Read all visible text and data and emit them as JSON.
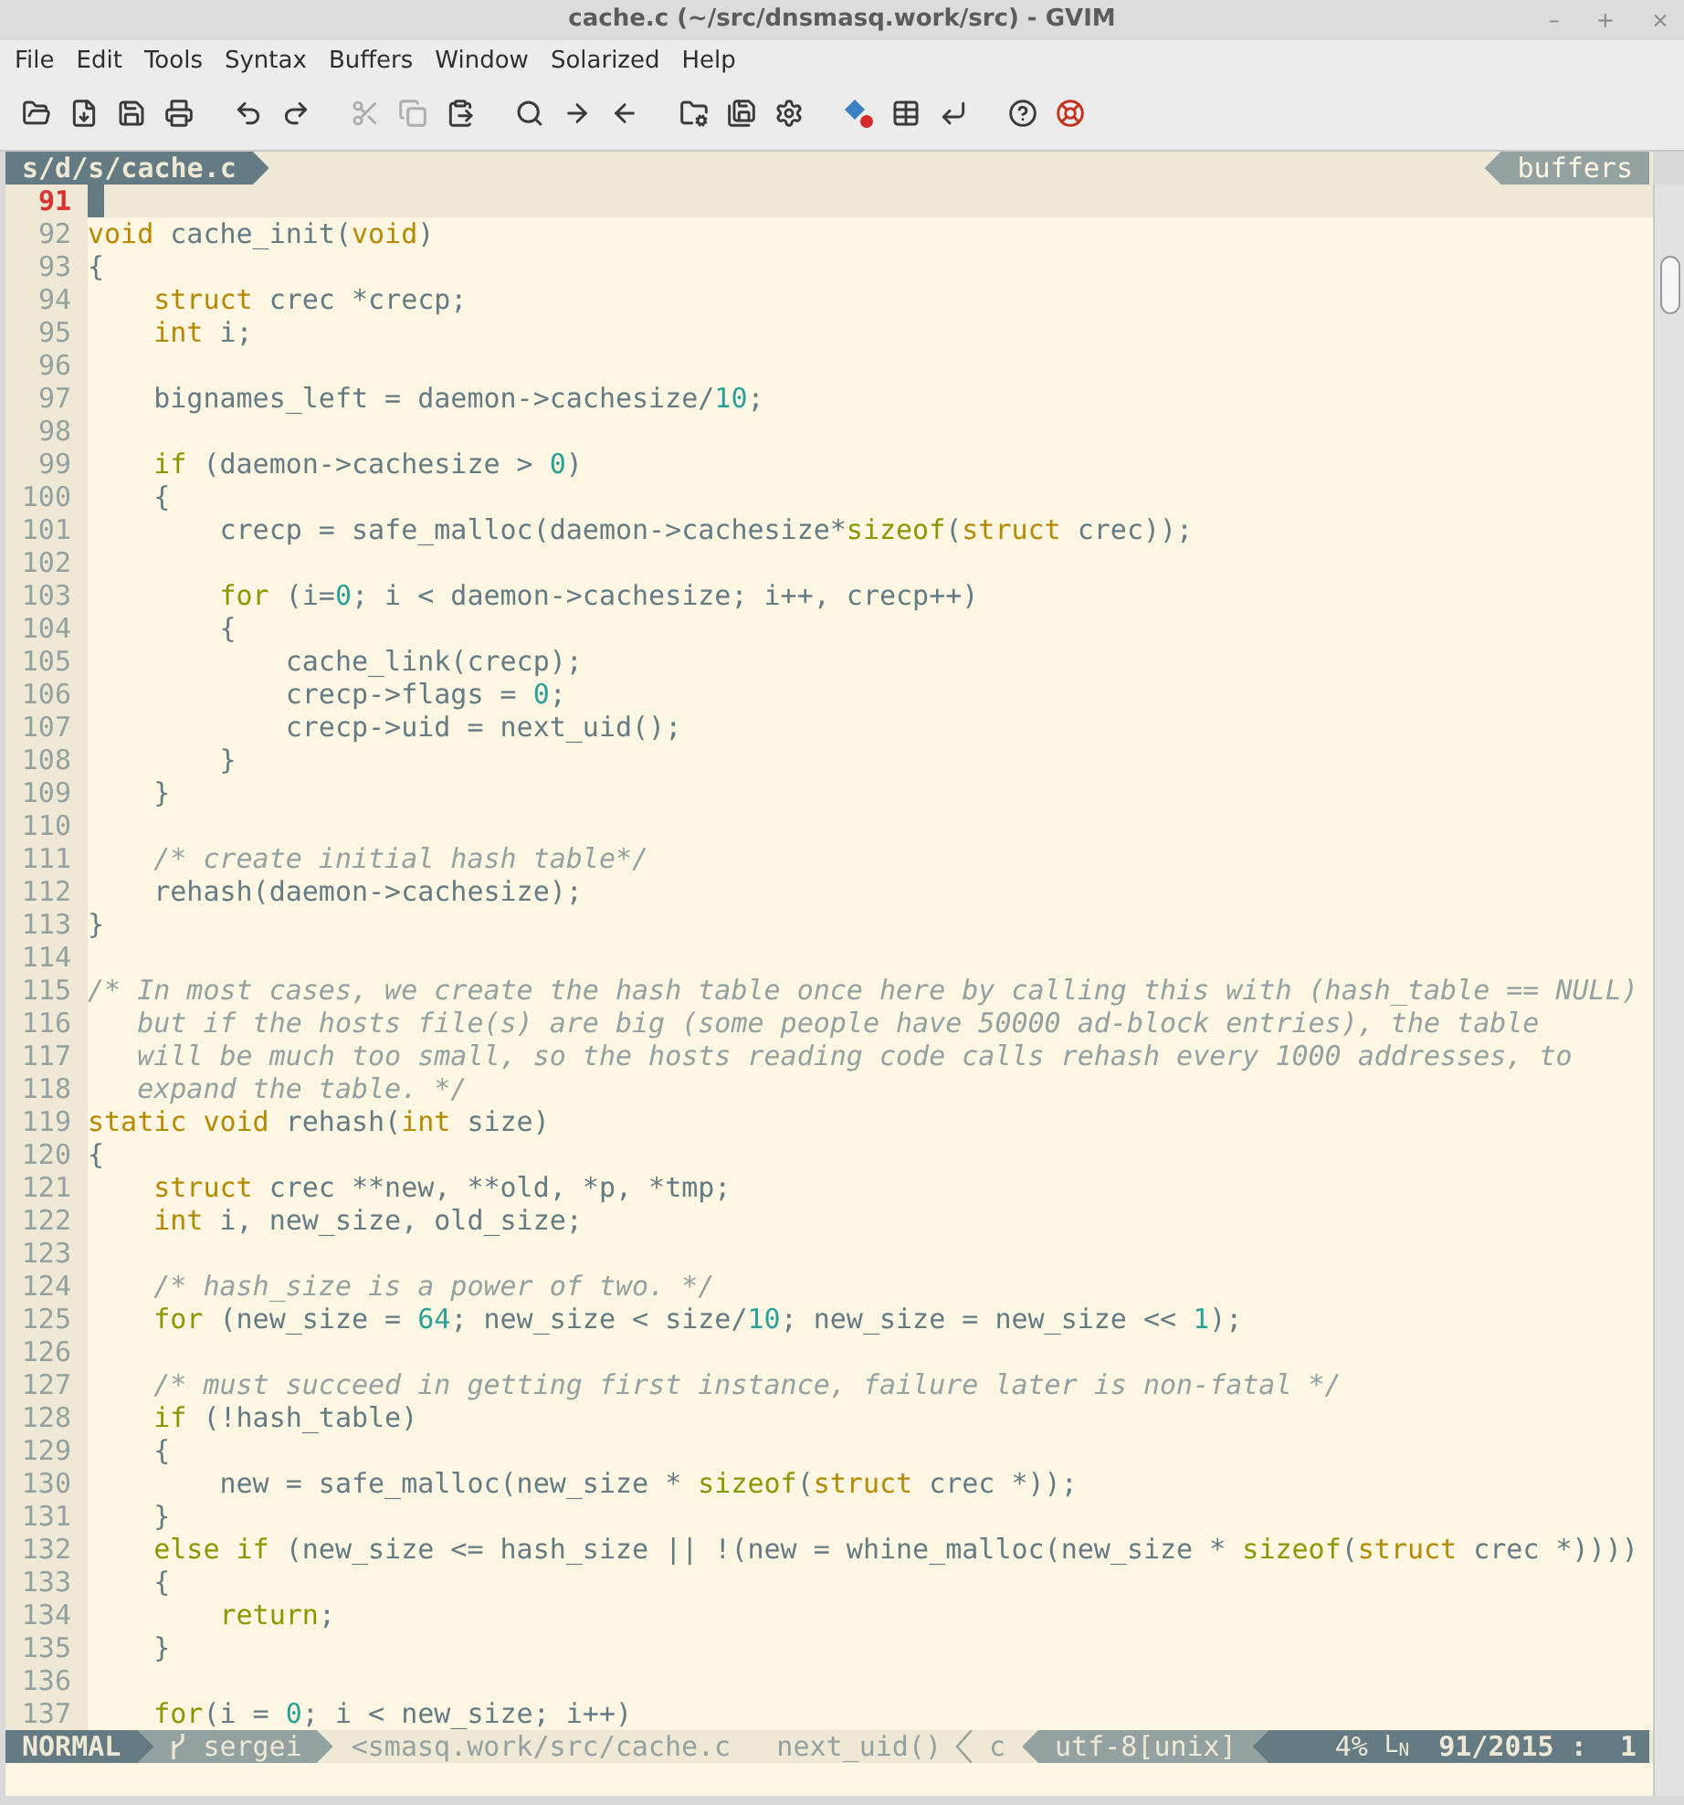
{
  "window": {
    "title": "cache.c (~/src/dnsmasq.work/src) - GVIM",
    "controls": [
      "–",
      "+",
      "×"
    ]
  },
  "menu": [
    "File",
    "Edit",
    "Tools",
    "Syntax",
    "Buffers",
    "Window",
    "Solarized",
    "Help"
  ],
  "toolbar": {
    "groups": [
      {
        "buttons": [
          {
            "disabled": false
          },
          {
            "disabled": false
          },
          {
            "disabled": false
          },
          {
            "disabled": false
          }
        ]
      },
      {
        "buttons": [
          {
            "disabled": false
          },
          {
            "disabled": false
          }
        ]
      },
      {
        "buttons": [
          {
            "disabled": true
          },
          {
            "disabled": true
          },
          {
            "disabled": false
          }
        ]
      },
      {
        "buttons": [
          {
            "disabled": false
          },
          {
            "disabled": false
          },
          {
            "disabled": false
          }
        ]
      },
      {
        "buttons": [
          {
            "disabled": false
          },
          {
            "disabled": false
          },
          {
            "disabled": false
          }
        ]
      },
      {
        "buttons": [
          {
            "disabled": false
          },
          {
            "disabled": false
          },
          {
            "disabled": false
          }
        ]
      },
      {
        "buttons": [
          {
            "disabled": false
          },
          {
            "disabled": false
          }
        ]
      }
    ]
  },
  "tabline": {
    "tab": "s/d/s/cache.c",
    "label": "buffers"
  },
  "editor": {
    "cursor_line": {
      "number": "91"
    },
    "lines": [
      {
        "number": "92",
        "segments": [
          {
            "kind": "type",
            "text": "void"
          },
          {
            "kind": "plain",
            "text": " cache_init("
          },
          {
            "kind": "type",
            "text": "void"
          },
          {
            "kind": "plain",
            "text": ")"
          }
        ]
      },
      {
        "number": "93",
        "segments": [
          {
            "kind": "plain",
            "text": "{"
          }
        ]
      },
      {
        "number": "94",
        "segments": [
          {
            "kind": "type",
            "text": "    struct"
          },
          {
            "kind": "plain",
            "text": " crec *crecp;"
          }
        ]
      },
      {
        "number": "95",
        "segments": [
          {
            "kind": "type",
            "text": "    int"
          },
          {
            "kind": "plain",
            "text": " i;"
          }
        ]
      },
      {
        "number": "96"
      },
      {
        "number": "97",
        "segments": [
          {
            "kind": "plain",
            "text": "    bignames_left = daemon->cachesize/"
          },
          {
            "kind": "number",
            "text": "10"
          },
          {
            "kind": "plain",
            "text": ";"
          }
        ]
      },
      {
        "number": "98"
      },
      {
        "number": "99",
        "segments": [
          {
            "kind": "keyword",
            "text": "    if"
          },
          {
            "kind": "plain",
            "text": " (daemon->cachesize > "
          },
          {
            "kind": "number",
            "text": "0"
          },
          {
            "kind": "plain",
            "text": ")"
          }
        ]
      },
      {
        "number": "100",
        "segments": [
          {
            "kind": "plain",
            "text": "    {"
          }
        ]
      },
      {
        "number": "101",
        "segments": [
          {
            "kind": "plain",
            "text": "        crecp = safe_malloc(daemon->cachesize*"
          },
          {
            "kind": "keyword",
            "text": "sizeof"
          },
          {
            "kind": "plain",
            "text": "("
          },
          {
            "kind": "type",
            "text": "struct"
          },
          {
            "kind": "plain",
            "text": " crec));"
          }
        ]
      },
      {
        "number": "102"
      },
      {
        "number": "103",
        "segments": [
          {
            "kind": "keyword",
            "text": "        for"
          },
          {
            "kind": "plain",
            "text": " (i="
          },
          {
            "kind": "number",
            "text": "0"
          },
          {
            "kind": "plain",
            "text": "; i < daemon->cachesize; i++, crecp++)"
          }
        ]
      },
      {
        "number": "104",
        "segments": [
          {
            "kind": "plain",
            "text": "        {"
          }
        ]
      },
      {
        "number": "105",
        "segments": [
          {
            "kind": "plain",
            "text": "            cache_link(crecp);"
          }
        ]
      },
      {
        "number": "106",
        "segments": [
          {
            "kind": "plain",
            "text": "            crecp->flags = "
          },
          {
            "kind": "number",
            "text": "0"
          },
          {
            "kind": "plain",
            "text": ";"
          }
        ]
      },
      {
        "number": "107",
        "segments": [
          {
            "kind": "plain",
            "text": "            crecp->uid = next_uid();"
          }
        ]
      },
      {
        "number": "108",
        "segments": [
          {
            "kind": "plain",
            "text": "        }"
          }
        ]
      },
      {
        "number": "109",
        "segments": [
          {
            "kind": "plain",
            "text": "    }"
          }
        ]
      },
      {
        "number": "110"
      },
      {
        "number": "111",
        "segments": [
          {
            "kind": "comment",
            "text": "    /* create initial hash table*/"
          }
        ]
      },
      {
        "number": "112",
        "segments": [
          {
            "kind": "plain",
            "text": "    rehash(daemon->cachesize);"
          }
        ]
      },
      {
        "number": "113",
        "segments": [
          {
            "kind": "plain",
            "text": "}"
          }
        ]
      },
      {
        "number": "114"
      },
      {
        "number": "115",
        "segments": [
          {
            "kind": "comment",
            "text": "/* In most cases, we create the hash table once here by calling this with (hash_table == NULL)"
          }
        ]
      },
      {
        "number": "116",
        "segments": [
          {
            "kind": "comment",
            "text": "   but if the hosts file(s) are big (some people have 50000 ad-block entries), the table"
          }
        ]
      },
      {
        "number": "117",
        "segments": [
          {
            "kind": "comment",
            "text": "   will be much too small, so the hosts reading code calls rehash every 1000 addresses, to"
          }
        ]
      },
      {
        "number": "118",
        "segments": [
          {
            "kind": "comment",
            "text": "   expand the table. */"
          }
        ]
      },
      {
        "number": "119",
        "segments": [
          {
            "kind": "type",
            "text": "static void"
          },
          {
            "kind": "plain",
            "text": " rehash("
          },
          {
            "kind": "type",
            "text": "int"
          },
          {
            "kind": "plain",
            "text": " size)"
          }
        ]
      },
      {
        "number": "120",
        "segments": [
          {
            "kind": "plain",
            "text": "{"
          }
        ]
      },
      {
        "number": "121",
        "segments": [
          {
            "kind": "type",
            "text": "    struct"
          },
          {
            "kind": "plain",
            "text": " crec **new, **old, *p, *tmp;"
          }
        ]
      },
      {
        "number": "122",
        "segments": [
          {
            "kind": "type",
            "text": "    int"
          },
          {
            "kind": "plain",
            "text": " i, new_size, old_size;"
          }
        ]
      },
      {
        "number": "123"
      },
      {
        "number": "124",
        "segments": [
          {
            "kind": "comment",
            "text": "    /* hash_size is a power of two. */"
          }
        ]
      },
      {
        "number": "125",
        "segments": [
          {
            "kind": "keyword",
            "text": "    for"
          },
          {
            "kind": "plain",
            "text": " (new_size = "
          },
          {
            "kind": "number",
            "text": "64"
          },
          {
            "kind": "plain",
            "text": "; new_size < size/"
          },
          {
            "kind": "number",
            "text": "10"
          },
          {
            "kind": "plain",
            "text": "; new_size = new_size << "
          },
          {
            "kind": "number",
            "text": "1"
          },
          {
            "kind": "plain",
            "text": ");"
          }
        ]
      },
      {
        "number": "126"
      },
      {
        "number": "127",
        "segments": [
          {
            "kind": "comment",
            "text": "    /* must succeed in getting first instance, failure later is non-fatal */"
          }
        ]
      },
      {
        "number": "128",
        "segments": [
          {
            "kind": "keyword",
            "text": "    if"
          },
          {
            "kind": "plain",
            "text": " (!hash_table)"
          }
        ]
      },
      {
        "number": "129",
        "segments": [
          {
            "kind": "plain",
            "text": "    {"
          }
        ]
      },
      {
        "number": "130",
        "segments": [
          {
            "kind": "plain",
            "text": "        new = safe_malloc(new_size * "
          },
          {
            "kind": "keyword",
            "text": "sizeof"
          },
          {
            "kind": "plain",
            "text": "("
          },
          {
            "kind": "type",
            "text": "struct"
          },
          {
            "kind": "plain",
            "text": " crec *));"
          }
        ]
      },
      {
        "number": "131",
        "segments": [
          {
            "kind": "plain",
            "text": "    }"
          }
        ]
      },
      {
        "number": "132",
        "segments": [
          {
            "kind": "keyword",
            "text": "    else if"
          },
          {
            "kind": "plain",
            "text": " (new_size <= hash_size || !(new = whine_malloc(new_size * "
          },
          {
            "kind": "keyword",
            "text": "sizeof"
          },
          {
            "kind": "plain",
            "text": "("
          },
          {
            "kind": "type",
            "text": "struct"
          },
          {
            "kind": "plain",
            "text": " crec *))))"
          }
        ]
      },
      {
        "number": "133",
        "segments": [
          {
            "kind": "plain",
            "text": "    {"
          }
        ]
      },
      {
        "number": "134",
        "segments": [
          {
            "kind": "keyword",
            "text": "        return"
          },
          {
            "kind": "plain",
            "text": ";"
          }
        ]
      },
      {
        "number": "135",
        "segments": [
          {
            "kind": "plain",
            "text": "    }"
          }
        ]
      },
      {
        "number": "136"
      },
      {
        "number": "137",
        "segments": [
          {
            "kind": "keyword",
            "text": "    for"
          },
          {
            "kind": "plain",
            "text": "(i = "
          },
          {
            "kind": "number",
            "text": "0"
          },
          {
            "kind": "plain",
            "text": "; i < new_size; i++)"
          }
        ]
      }
    ]
  },
  "status_line": {
    "mode": "NORMAL",
    "branch": "sergei",
    "file": "<smasq.work/src/cache.c",
    "function": "next_uid()",
    "filetype": "c",
    "encoding": "utf-8[unix]",
    "percent": "4%",
    "line_symbol": "L$_{N}$",
    "position": "91/2015 :  1"
  }
}
